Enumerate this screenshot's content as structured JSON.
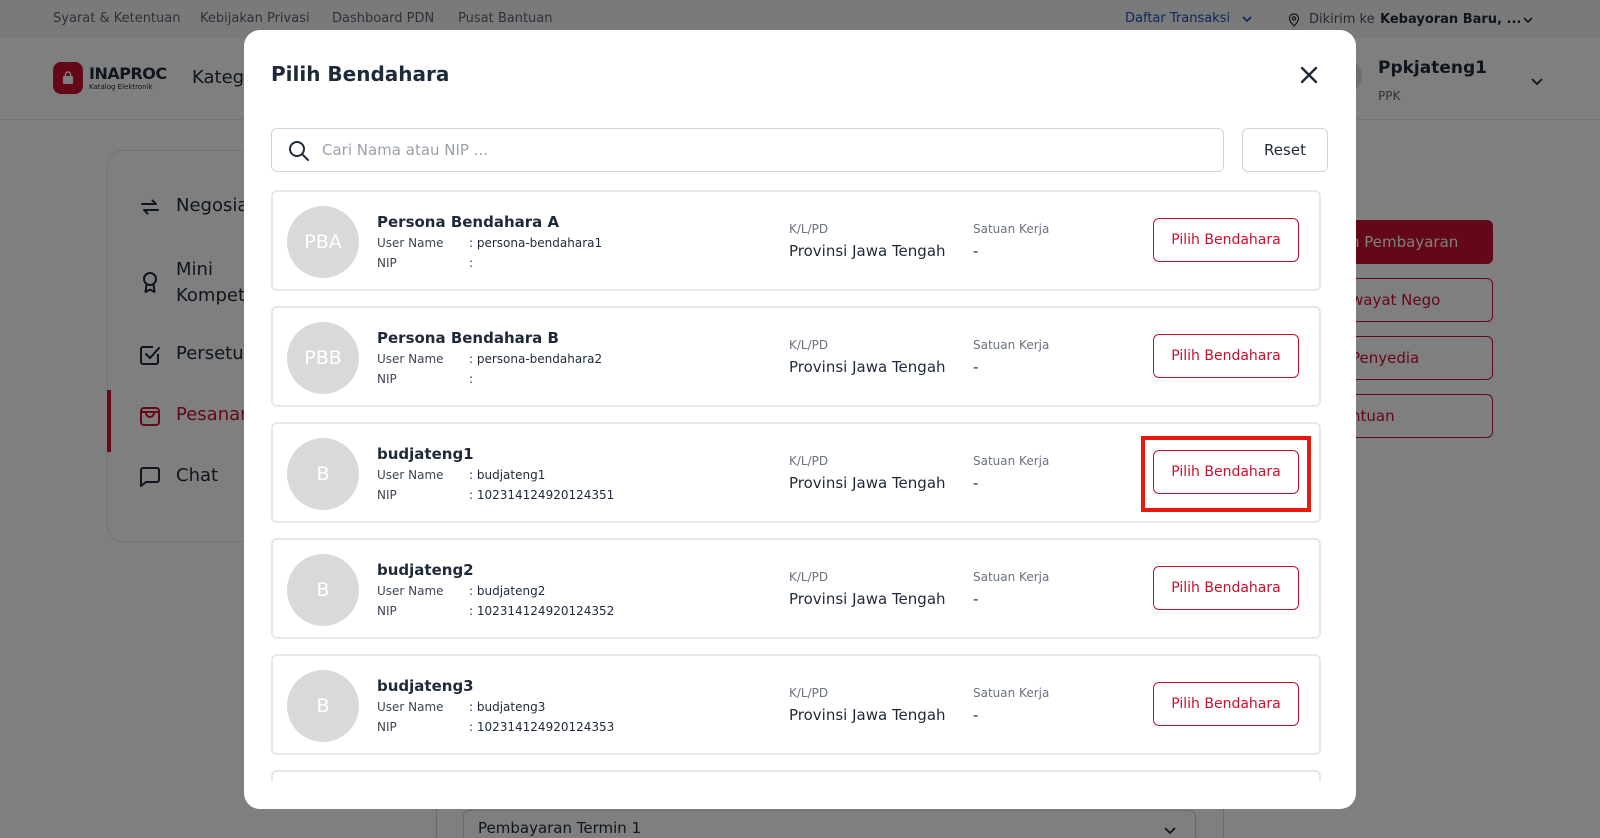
{
  "topbar": {
    "links": [
      "Syarat & Ketentuan",
      "Kebijakan Privasi",
      "Dashboard PDN",
      "Pusat Bantuan"
    ],
    "daftar_transaksi": "Daftar Transaksi",
    "dikirim_label": "Dikirim ke",
    "lokasi": "Kebayoran Baru, ..."
  },
  "header": {
    "logo_text": "INAPROC",
    "logo_sub": "Katalog Elektronik",
    "kategori": "Kateg",
    "user_name": "Ppkjateng1",
    "user_role": "PPK"
  },
  "sidebar": {
    "items": [
      {
        "label": "Negosia"
      },
      {
        "label": "Mini\nKompet"
      },
      {
        "label": "Persetu"
      },
      {
        "label": "Pesanan"
      },
      {
        "label": "Chat"
      }
    ]
  },
  "right_actions": [
    "n Pembayaran",
    "wayat Nego",
    "Penyedia",
    "ntuan"
  ],
  "bottom_field": "Pembayaran Termin 1",
  "modal": {
    "title": "Pilih Bendahara",
    "search_placeholder": "Cari Nama atau NIP ...",
    "search_value": "",
    "reset_label": "Reset",
    "field_labels": {
      "username": "User Name",
      "nip": "NIP",
      "kl": "K/L/PD",
      "satuan": "Satuan Kerja"
    },
    "pick_label": "Pilih Bendahara",
    "persons": [
      {
        "initials": "PBA",
        "name": "Persona Bendahara A",
        "username": ": persona-bendahara1",
        "nip": ":",
        "kl": "Provinsi Jawa Tengah",
        "satuan": "-"
      },
      {
        "initials": "PBB",
        "name": "Persona Bendahara B",
        "username": ": persona-bendahara2",
        "nip": ":",
        "kl": "Provinsi Jawa Tengah",
        "satuan": "-"
      },
      {
        "initials": "B",
        "name": "budjateng1",
        "username": ": budjateng1",
        "nip": ": 102314124920124351",
        "kl": "Provinsi Jawa Tengah",
        "satuan": "-"
      },
      {
        "initials": "B",
        "name": "budjateng2",
        "username": ": budjateng2",
        "nip": ": 102314124920124352",
        "kl": "Provinsi Jawa Tengah",
        "satuan": "-"
      },
      {
        "initials": "B",
        "name": "budjateng3",
        "username": ": budjateng3",
        "nip": ": 102314124920124353",
        "kl": "Provinsi Jawa Tengah",
        "satuan": "-"
      }
    ]
  },
  "colors": {
    "brand": "#c8102e",
    "highlight": "#e8180c",
    "link_blue": "#1f4fb5"
  }
}
